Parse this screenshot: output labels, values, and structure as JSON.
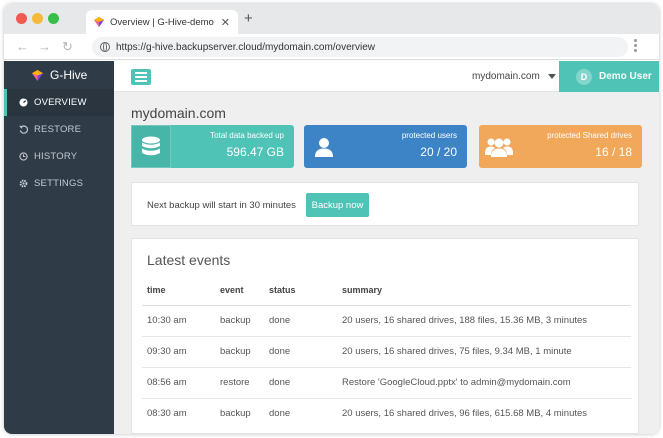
{
  "browser": {
    "tab_title": "Overview | G-Hive-demo",
    "tab_close": "✕",
    "new_tab": "+",
    "url": "https://g-hive.backupserver.cloud/mydomain.com/overview",
    "back": "←",
    "forward": "→",
    "reload": "↻"
  },
  "app": {
    "brand": "G-Hive",
    "accent_color": "#4fc3b6",
    "sidebar_color": "#2f3b47"
  },
  "sidebar": {
    "items": [
      {
        "label": "OVERVIEW",
        "icon": "dashboard-icon",
        "active": true
      },
      {
        "label": "RESTORE",
        "icon": "restore-icon",
        "active": false
      },
      {
        "label": "HISTORY",
        "icon": "clock-icon",
        "active": false
      },
      {
        "label": "SETTINGS",
        "icon": "gear-icon",
        "active": false
      }
    ]
  },
  "topbar": {
    "domain": "mydomain.com",
    "user_initial": "D",
    "user_name": "Demo User"
  },
  "main": {
    "title": "mydomain.com",
    "stats": [
      {
        "label": "Total data backed up",
        "value": "596.47 GB",
        "icon": "database-icon",
        "color": "#4fc3b6"
      },
      {
        "label": "protected users",
        "value": "20 / 20",
        "icon": "user-icon",
        "color": "#3d84c6"
      },
      {
        "label": "protected Shared drives",
        "value": "16 / 18",
        "icon": "users-group-icon",
        "color": "#f1a85a"
      }
    ],
    "backup": {
      "next_text": "Next backup will start in 30 minutes",
      "button_label": "Backup now"
    },
    "events": {
      "title": "Latest events",
      "columns": [
        "time",
        "event",
        "status",
        "summary"
      ],
      "rows": [
        {
          "time": "10:30 am",
          "event": "backup",
          "status": "done",
          "summary": "20 users, 16 shared drives, 188 files, 15.36 MB, 3 minutes"
        },
        {
          "time": "09:30 am",
          "event": "backup",
          "status": "done",
          "summary": "20 users, 16 shared drives, 75 files, 9.34 MB, 1 minute"
        },
        {
          "time": "08:56 am",
          "event": "restore",
          "status": "done",
          "summary": "Restore 'GoogleCloud.pptx' to admin@mydomain.com"
        },
        {
          "time": "08:30 am",
          "event": "backup",
          "status": "done",
          "summary": "20 users, 16 shared drives, 96 files, 615.68 MB, 4 minutes"
        }
      ]
    }
  }
}
